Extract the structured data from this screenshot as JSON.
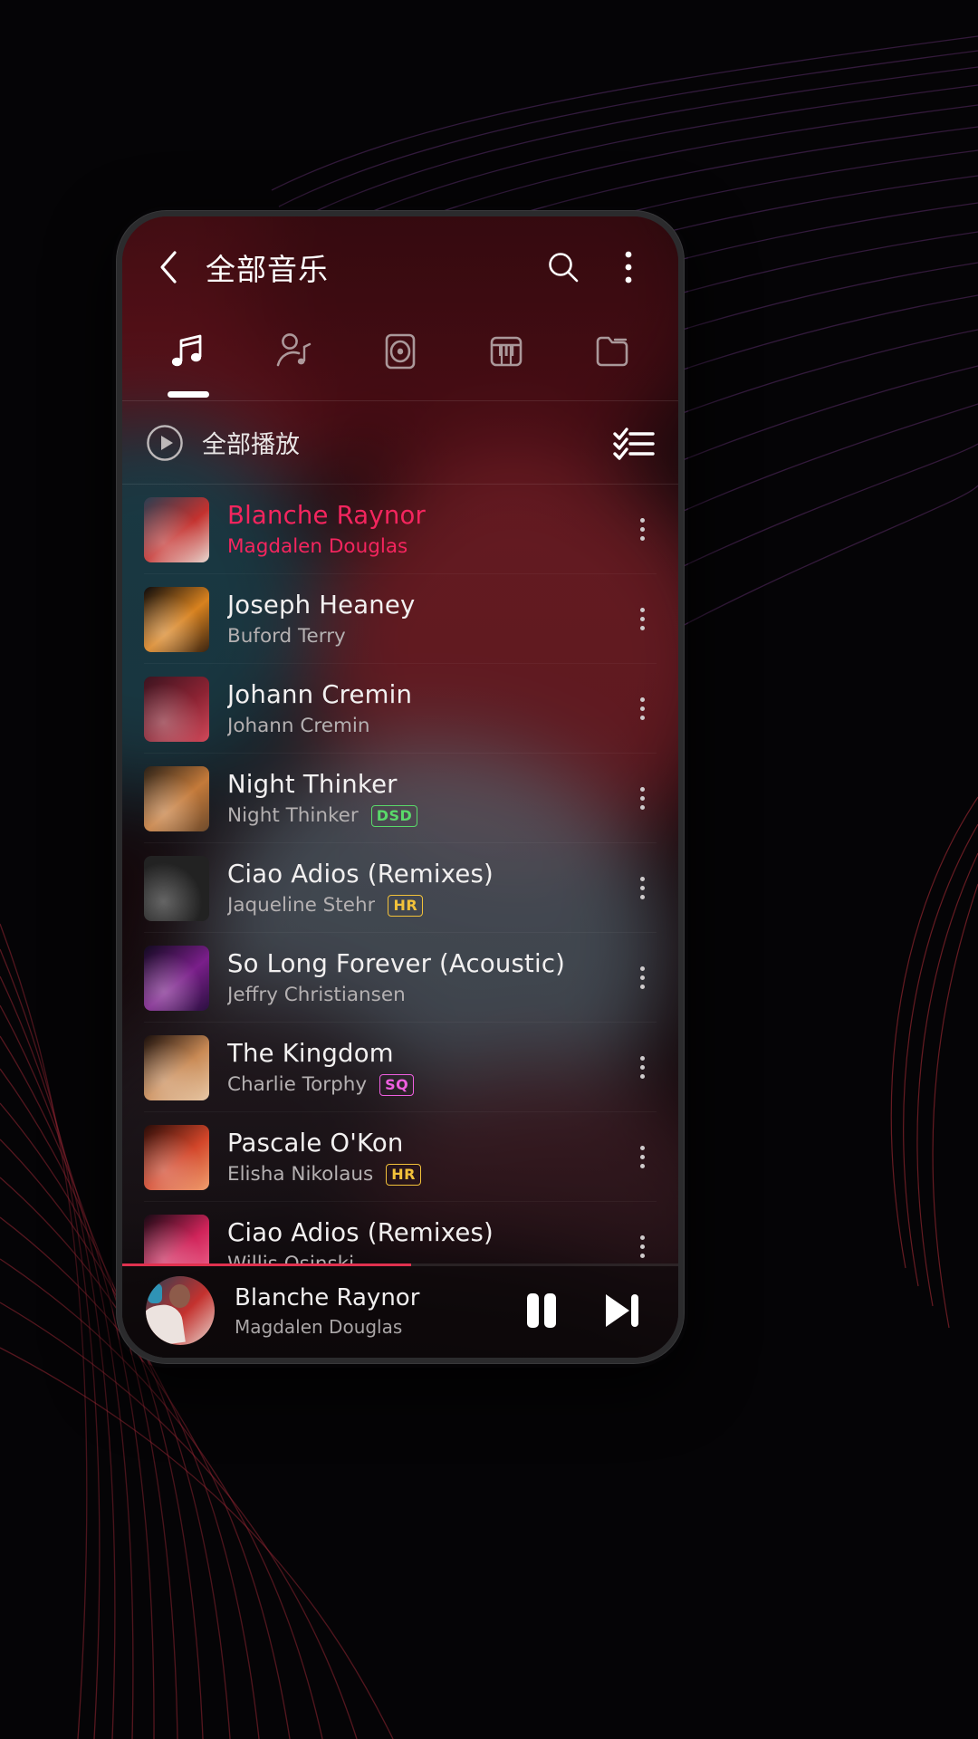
{
  "app": {
    "header": {
      "back_icon": "chevron-left-icon",
      "title": "全部音乐",
      "search_icon": "search-icon",
      "overflow_icon": "more-vertical-icon"
    },
    "tabs": [
      {
        "name": "songs",
        "icon": "music-note-icon",
        "active": true
      },
      {
        "name": "artists",
        "icon": "artist-icon",
        "active": false
      },
      {
        "name": "albums",
        "icon": "album-disc-icon",
        "active": false
      },
      {
        "name": "genres",
        "icon": "piano-keys-icon",
        "active": false
      },
      {
        "name": "folders",
        "icon": "folder-icon",
        "active": false
      }
    ],
    "play_all": {
      "play_icon": "play-circle-icon",
      "label": "全部播放",
      "multiselect_icon": "checklist-icon"
    },
    "songs": [
      {
        "title": "Blanche Raynor",
        "artist": "Magdalen Douglas",
        "badge": "",
        "playing": true,
        "art": [
          "#2a3f52",
          "#c4322f",
          "#e8d9d2"
        ]
      },
      {
        "title": "Joseph Heaney",
        "artist": "Buford Terry",
        "badge": "",
        "playing": false,
        "art": [
          "#0c0b0d",
          "#d8821f",
          "#3a2412"
        ]
      },
      {
        "title": "Johann Cremin",
        "artist": "Johann Cremin",
        "badge": "",
        "playing": false,
        "art": [
          "#3b1420",
          "#8c2333",
          "#d0495a"
        ]
      },
      {
        "title": "Night Thinker",
        "artist": "Night Thinker",
        "badge": "DSD",
        "playing": false,
        "art": [
          "#2a2118",
          "#c47a3a",
          "#6d4a2c"
        ]
      },
      {
        "title": "Ciao Adios (Remixes)",
        "artist": "Jaqueline Stehr",
        "badge": "HR",
        "playing": false,
        "art": [
          "#56c8d8",
          "#e3a martial",
          "#d8953f"
        ]
      },
      {
        "title": "So Long Forever (Acoustic)",
        "artist": "Jeffry Christiansen",
        "badge": "",
        "playing": false,
        "art": [
          "#120a20",
          "#7a1f8a",
          "#2a1040"
        ]
      },
      {
        "title": "The Kingdom",
        "artist": "Charlie Torphy",
        "badge": "SQ",
        "playing": false,
        "art": [
          "#1a0f0c",
          "#c98a55",
          "#e8c9a8"
        ]
      },
      {
        "title": "Pascale O'Kon",
        "artist": "Elisha Nikolaus",
        "badge": "HR",
        "playing": false,
        "art": [
          "#2a0c08",
          "#d3462a",
          "#f0a070"
        ]
      },
      {
        "title": "Ciao Adios (Remixes)",
        "artist": "Willis Osinski",
        "badge": "",
        "playing": false,
        "art": [
          "#180a14",
          "#d0245a",
          "#f06a90"
        ]
      }
    ],
    "badge_colors": {
      "DSD": "#5ad96a",
      "HR": "#f2c13a",
      "SQ": "#ef5fe0"
    },
    "accent_playing": "#f4255e",
    "now_playing": {
      "title": "Blanche Raynor",
      "artist": "Magdalen Douglas",
      "pause_icon": "pause-icon",
      "next_icon": "next-track-icon",
      "progress_percent": 52
    }
  }
}
